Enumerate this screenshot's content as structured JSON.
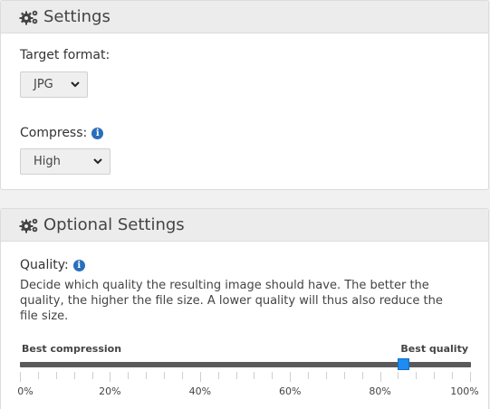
{
  "settings": {
    "title": "Settings",
    "target_format": {
      "label": "Target format:",
      "value": "JPG"
    },
    "compress": {
      "label": "Compress:",
      "value": "High"
    }
  },
  "optional": {
    "title": "Optional Settings",
    "quality": {
      "label": "Quality:",
      "description": "Decide which quality the resulting image should have. The better the quality, the higher the file size. A lower quality will thus also reduce the file size.",
      "min_caption": "Best compression",
      "max_caption": "Best quality",
      "value_percent": 85,
      "ticks": [
        "0%",
        "20%",
        "40%",
        "60%",
        "80%",
        "100%"
      ]
    }
  },
  "colors": {
    "accent": "#1e8cf0",
    "info": "#2a6ebb",
    "track": "#5a5a5a"
  },
  "icons": [
    "gears-icon",
    "info-icon",
    "chevron-down-icon"
  ]
}
